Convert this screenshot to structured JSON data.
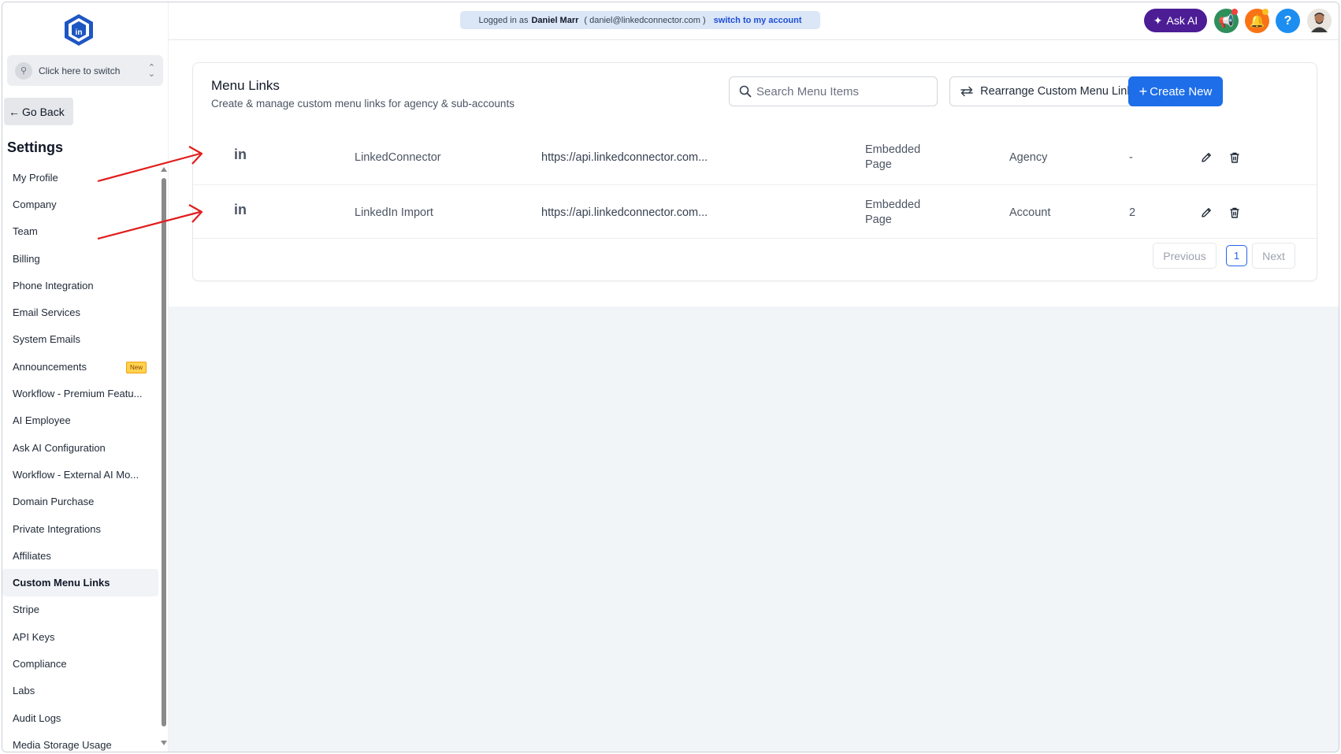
{
  "topbar": {
    "logged_in_prefix": "Logged in as",
    "user_name": "Daniel Marr",
    "user_email": "( daniel@linkedconnector.com )",
    "switch_link": "switch to my account",
    "ask_ai": "Ask AI",
    "help_glyph": "?"
  },
  "sidebar": {
    "switcher_label": "Click here to switch",
    "go_back": "Go Back",
    "settings_title": "Settings",
    "new_badge": "New",
    "items": [
      {
        "label": "My Profile"
      },
      {
        "label": "Company"
      },
      {
        "label": "Team"
      },
      {
        "label": "Billing"
      },
      {
        "label": "Phone Integration"
      },
      {
        "label": "Email Services"
      },
      {
        "label": "System Emails"
      },
      {
        "label": "Announcements"
      },
      {
        "label": "Workflow - Premium Featu..."
      },
      {
        "label": "AI Employee"
      },
      {
        "label": "Ask AI Configuration"
      },
      {
        "label": "Workflow - External AI Mo..."
      },
      {
        "label": "Domain Purchase"
      },
      {
        "label": "Private Integrations"
      },
      {
        "label": "Affiliates"
      },
      {
        "label": "Custom Menu Links"
      },
      {
        "label": "Stripe"
      },
      {
        "label": "API Keys"
      },
      {
        "label": "Compliance"
      },
      {
        "label": "Labs"
      },
      {
        "label": "Audit Logs"
      },
      {
        "label": "Media Storage Usage"
      }
    ],
    "active_item": "Custom Menu Links"
  },
  "main": {
    "title": "Menu Links",
    "subtitle": "Create & manage custom menu links for agency & sub-accounts",
    "search_placeholder": "Search Menu Items",
    "rearrange_label": "Rearrange Custom Menu Links",
    "create_label": "Create New",
    "rows": [
      {
        "icon": "in",
        "name": "LinkedConnector",
        "url": "https://api.linkedconnector.com...",
        "type_line1": "Embedded",
        "type_line2": "Page",
        "access": "Agency",
        "count": "-"
      },
      {
        "icon": "in",
        "name": "LinkedIn Import",
        "url": "https://api.linkedconnector.com...",
        "type_line1": "Embedded",
        "type_line2": "Page",
        "access": "Account",
        "count": "2"
      }
    ],
    "pagination": {
      "previous": "Previous",
      "current": "1",
      "next": "Next"
    }
  },
  "colors": {
    "primary": "#1d6ee8",
    "ask_ai_bg": "#4c1d95",
    "annotation_arrow": "#e11d1d"
  }
}
